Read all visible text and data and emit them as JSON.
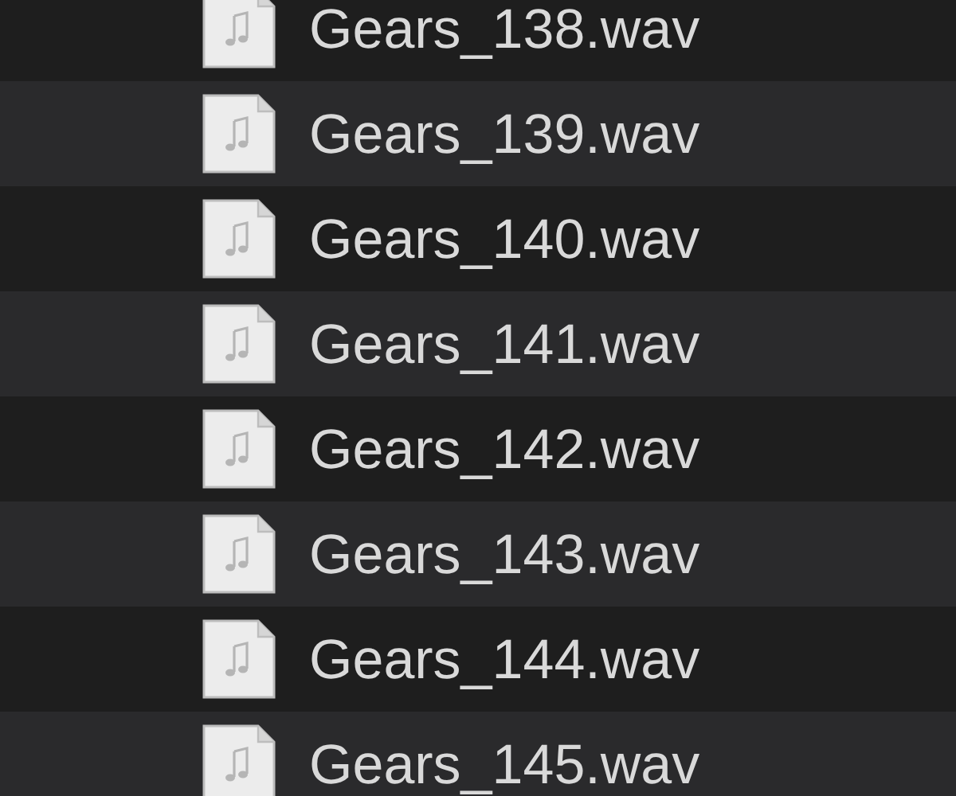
{
  "files": [
    {
      "name": "Gears_138.wav"
    },
    {
      "name": "Gears_139.wav"
    },
    {
      "name": "Gears_140.wav"
    },
    {
      "name": "Gears_141.wav"
    },
    {
      "name": "Gears_142.wav"
    },
    {
      "name": "Gears_143.wav"
    },
    {
      "name": "Gears_144.wav"
    },
    {
      "name": "Gears_145.wav"
    }
  ]
}
